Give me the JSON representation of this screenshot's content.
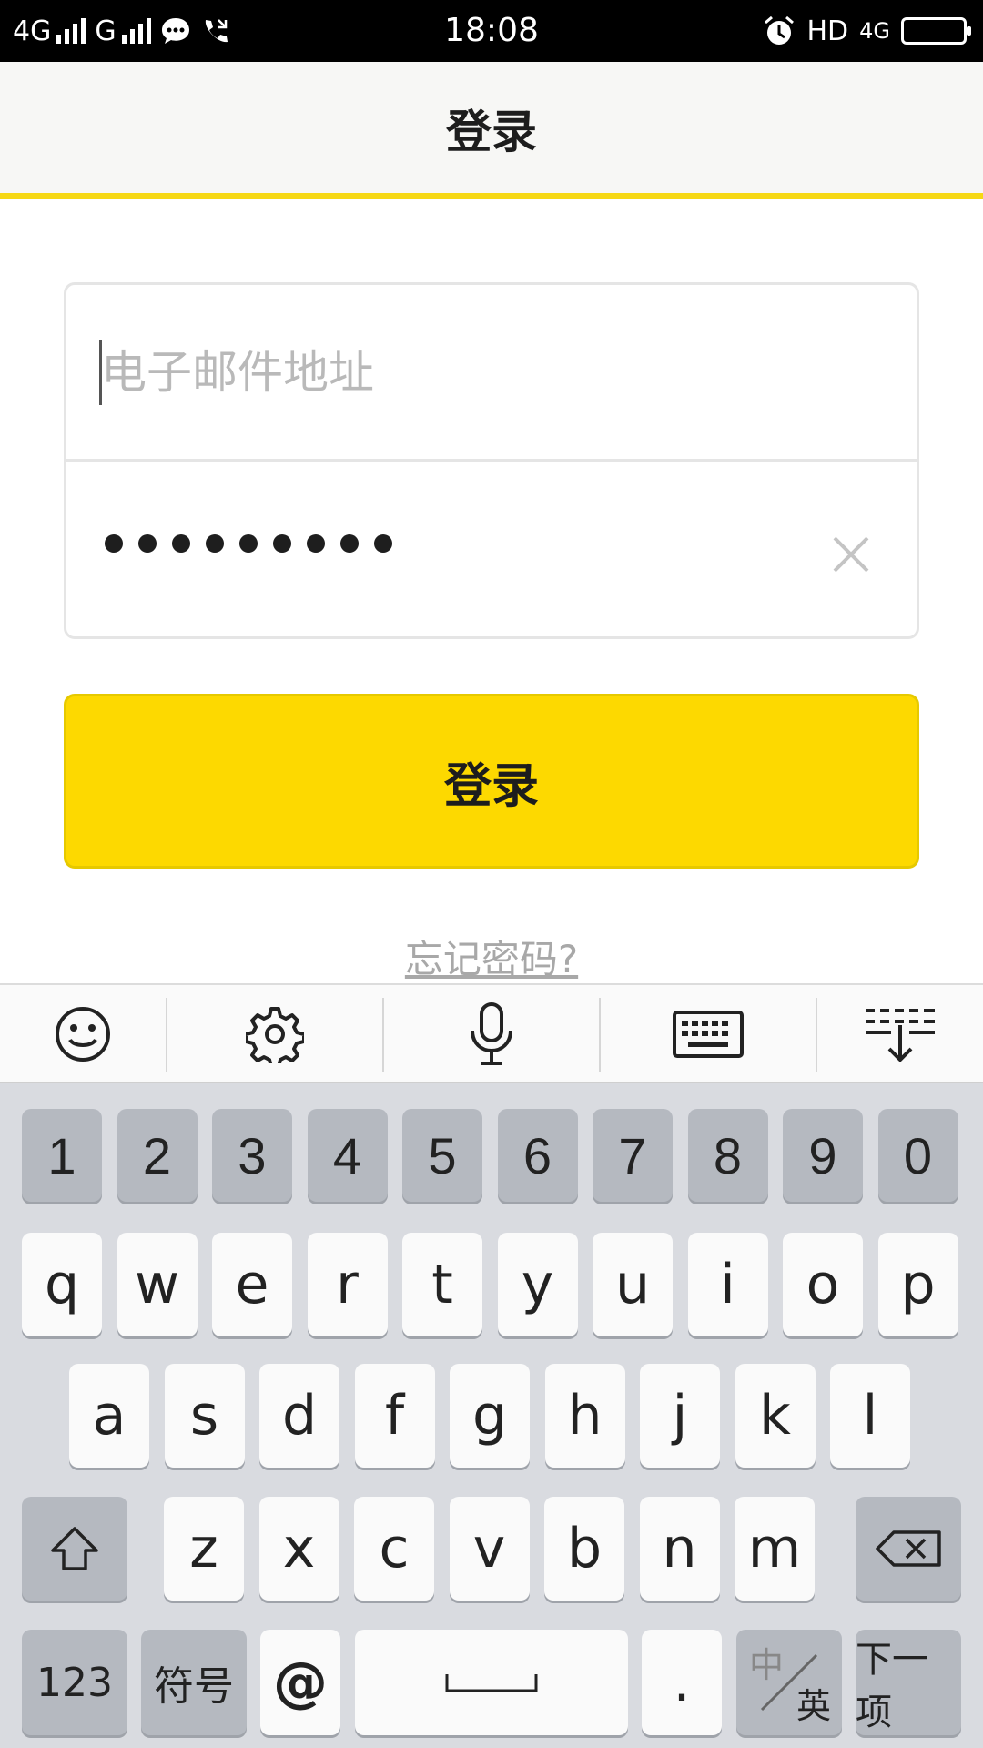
{
  "status_bar": {
    "network1": "4G",
    "network2": "G",
    "time": "18:08",
    "hd": "HD",
    "net_right": "4G"
  },
  "header": {
    "title": "登录"
  },
  "form": {
    "email_placeholder": "电子邮件地址",
    "password_length": 9
  },
  "login_button": {
    "label": "登录"
  },
  "forgot_link": {
    "label": "忘记密码?"
  },
  "keyboard": {
    "toolbar": [
      "emoji-icon",
      "settings-icon",
      "microphone-icon",
      "keyboard-icon",
      "collapse-keyboard-icon"
    ],
    "row_numbers": [
      "1",
      "2",
      "3",
      "4",
      "5",
      "6",
      "7",
      "8",
      "9",
      "0"
    ],
    "row1": [
      "q",
      "w",
      "e",
      "r",
      "t",
      "y",
      "u",
      "i",
      "o",
      "p"
    ],
    "row2": [
      "a",
      "s",
      "d",
      "f",
      "g",
      "h",
      "j",
      "k",
      "l"
    ],
    "row3": [
      "z",
      "x",
      "c",
      "v",
      "b",
      "n",
      "m"
    ],
    "bottom": {
      "num_label": "123",
      "symbol_label": "符号",
      "at_label": "@",
      "period_label": ".",
      "lang_top": "中",
      "lang_bottom": "英",
      "next_label": "下一项"
    }
  },
  "colors": {
    "accent": "#FDD900",
    "header_bg": "#F7F7F5",
    "keyboard_bg": "#D9DBE0"
  }
}
